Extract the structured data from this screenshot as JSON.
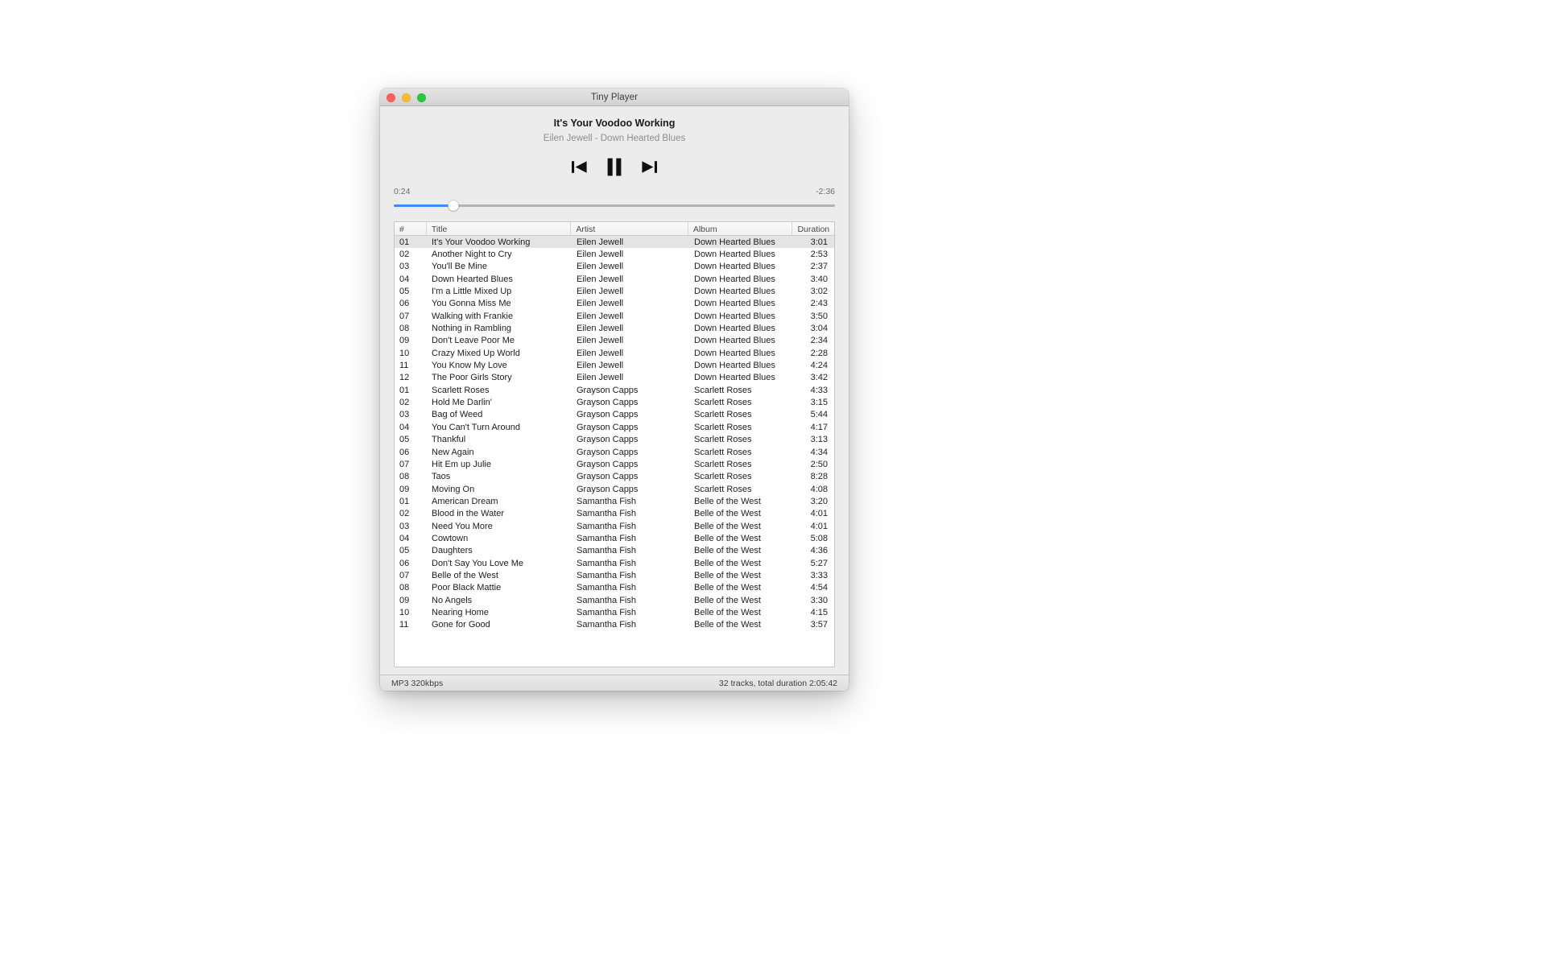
{
  "window": {
    "title": "Tiny Player",
    "traffic_lights": [
      {
        "name": "close",
        "color": "#ff5f57"
      },
      {
        "name": "minimize",
        "color": "#febc2e"
      },
      {
        "name": "zoom",
        "color": "#28c840"
      }
    ]
  },
  "now_playing": {
    "title": "It's Your Voodoo Working",
    "subtitle": "Eilen Jewell - Down Hearted Blues"
  },
  "transport": {
    "previous_label": "Previous",
    "pause_label": "Pause",
    "next_label": "Next"
  },
  "progress": {
    "elapsed": "0:24",
    "remaining": "-2:36",
    "percent": 13.5,
    "fill_color": "#3c8dfb",
    "track_color": "#b3b3b3"
  },
  "tracklist": {
    "columns": [
      "#",
      "Title",
      "Artist",
      "Album",
      "Duration"
    ],
    "selected_index": 0,
    "rows": [
      {
        "num": "01",
        "title": "It's Your Voodoo Working",
        "artist": "Eilen Jewell",
        "album": "Down Hearted Blues",
        "duration": "3:01"
      },
      {
        "num": "02",
        "title": "Another Night to Cry",
        "artist": "Eilen Jewell",
        "album": "Down Hearted Blues",
        "duration": "2:53"
      },
      {
        "num": "03",
        "title": "You'll Be Mine",
        "artist": "Eilen Jewell",
        "album": "Down Hearted Blues",
        "duration": "2:37"
      },
      {
        "num": "04",
        "title": "Down Hearted Blues",
        "artist": "Eilen Jewell",
        "album": "Down Hearted Blues",
        "duration": "3:40"
      },
      {
        "num": "05",
        "title": "I'm a Little Mixed Up",
        "artist": "Eilen Jewell",
        "album": "Down Hearted Blues",
        "duration": "3:02"
      },
      {
        "num": "06",
        "title": "You Gonna Miss Me",
        "artist": "Eilen Jewell",
        "album": "Down Hearted Blues",
        "duration": "2:43"
      },
      {
        "num": "07",
        "title": "Walking with Frankie",
        "artist": "Eilen Jewell",
        "album": "Down Hearted Blues",
        "duration": "3:50"
      },
      {
        "num": "08",
        "title": "Nothing in Rambling",
        "artist": "Eilen Jewell",
        "album": "Down Hearted Blues",
        "duration": "3:04"
      },
      {
        "num": "09",
        "title": "Don't Leave Poor Me",
        "artist": "Eilen Jewell",
        "album": "Down Hearted Blues",
        "duration": "2:34"
      },
      {
        "num": "10",
        "title": "Crazy Mixed Up World",
        "artist": "Eilen Jewell",
        "album": "Down Hearted Blues",
        "duration": "2:28"
      },
      {
        "num": "11",
        "title": "You Know My Love",
        "artist": "Eilen Jewell",
        "album": "Down Hearted Blues",
        "duration": "4:24"
      },
      {
        "num": "12",
        "title": "The Poor Girls Story",
        "artist": "Eilen Jewell",
        "album": "Down Hearted Blues",
        "duration": "3:42"
      },
      {
        "num": "01",
        "title": "Scarlett Roses",
        "artist": "Grayson Capps",
        "album": "Scarlett Roses",
        "duration": "4:33"
      },
      {
        "num": "02",
        "title": "Hold Me Darlin'",
        "artist": "Grayson Capps",
        "album": "Scarlett Roses",
        "duration": "3:15"
      },
      {
        "num": "03",
        "title": "Bag of Weed",
        "artist": "Grayson Capps",
        "album": "Scarlett Roses",
        "duration": "5:44"
      },
      {
        "num": "04",
        "title": "You Can't Turn Around",
        "artist": "Grayson Capps",
        "album": "Scarlett Roses",
        "duration": "4:17"
      },
      {
        "num": "05",
        "title": "Thankful",
        "artist": "Grayson Capps",
        "album": "Scarlett Roses",
        "duration": "3:13"
      },
      {
        "num": "06",
        "title": "New Again",
        "artist": "Grayson Capps",
        "album": "Scarlett Roses",
        "duration": "4:34"
      },
      {
        "num": "07",
        "title": "Hit Em up Julie",
        "artist": "Grayson Capps",
        "album": "Scarlett Roses",
        "duration": "2:50"
      },
      {
        "num": "08",
        "title": "Taos",
        "artist": "Grayson Capps",
        "album": "Scarlett Roses",
        "duration": "8:28"
      },
      {
        "num": "09",
        "title": "Moving On",
        "artist": "Grayson Capps",
        "album": "Scarlett Roses",
        "duration": "4:08"
      },
      {
        "num": "01",
        "title": "American Dream",
        "artist": "Samantha Fish",
        "album": "Belle of the West",
        "duration": "3:20"
      },
      {
        "num": "02",
        "title": "Blood in the Water",
        "artist": "Samantha Fish",
        "album": "Belle of the West",
        "duration": "4:01"
      },
      {
        "num": "03",
        "title": "Need You More",
        "artist": "Samantha Fish",
        "album": "Belle of the West",
        "duration": "4:01"
      },
      {
        "num": "04",
        "title": "Cowtown",
        "artist": "Samantha Fish",
        "album": "Belle of the West",
        "duration": "5:08"
      },
      {
        "num": "05",
        "title": "Daughters",
        "artist": "Samantha Fish",
        "album": "Belle of the West",
        "duration": "4:36"
      },
      {
        "num": "06",
        "title": "Don't Say You Love Me",
        "artist": "Samantha Fish",
        "album": "Belle of the West",
        "duration": "5:27"
      },
      {
        "num": "07",
        "title": "Belle of the West",
        "artist": "Samantha Fish",
        "album": "Belle of the West",
        "duration": "3:33"
      },
      {
        "num": "08",
        "title": "Poor Black Mattie",
        "artist": "Samantha Fish",
        "album": "Belle of the West",
        "duration": "4:54"
      },
      {
        "num": "09",
        "title": "No Angels",
        "artist": "Samantha Fish",
        "album": "Belle of the West",
        "duration": "3:30"
      },
      {
        "num": "10",
        "title": "Nearing Home",
        "artist": "Samantha Fish",
        "album": "Belle of the West",
        "duration": "4:15"
      },
      {
        "num": "11",
        "title": "Gone for Good",
        "artist": "Samantha Fish",
        "album": "Belle of the West",
        "duration": "3:57"
      }
    ]
  },
  "statusbar": {
    "format": "MP3 320kbps",
    "summary": "32 tracks, total duration 2:05:42"
  }
}
